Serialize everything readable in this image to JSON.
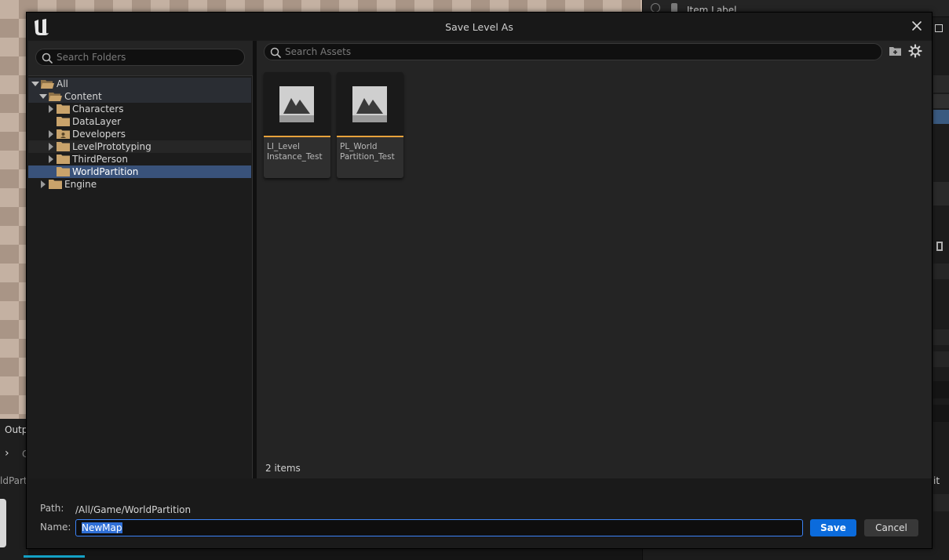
{
  "background": {
    "right_panel_header": "Item Label",
    "outliner_partial_text": "it",
    "output_tab": "Outp",
    "output_partial": "C",
    "bottom_left_partial": "ldPart"
  },
  "dialog": {
    "title": "Save Level As",
    "folder_search_placeholder": "Search Folders",
    "asset_search_placeholder": "Search Assets",
    "tree": [
      {
        "label": "All"
      },
      {
        "label": "Content"
      },
      {
        "label": "Characters"
      },
      {
        "label": "DataLayer"
      },
      {
        "label": "Developers"
      },
      {
        "label": "LevelPrototyping"
      },
      {
        "label": "ThirdPerson"
      },
      {
        "label": "WorldPartition"
      },
      {
        "label": "Engine"
      }
    ],
    "assets": [
      {
        "name": "LI_Level\nInstance_Test"
      },
      {
        "name": "PL_World\nPartition_Test"
      }
    ],
    "item_count": "2 items",
    "path_label": "Path:",
    "path_value": "/All/Game/WorldPartition",
    "name_label": "Name:",
    "name_value": "NewMap",
    "save_label": "Save",
    "cancel_label": "Cancel"
  },
  "colors": {
    "accent_blue": "#0b6bdc",
    "selection_blue": "#39527a",
    "folder_tan": "#c9a36b",
    "asset_underline": "#e8a23c"
  },
  "icons": [
    "unreal-logo-icon",
    "close-icon",
    "search-icon",
    "folder-icon",
    "add-folder-icon",
    "settings-gear-icon",
    "level-asset-icon"
  ]
}
